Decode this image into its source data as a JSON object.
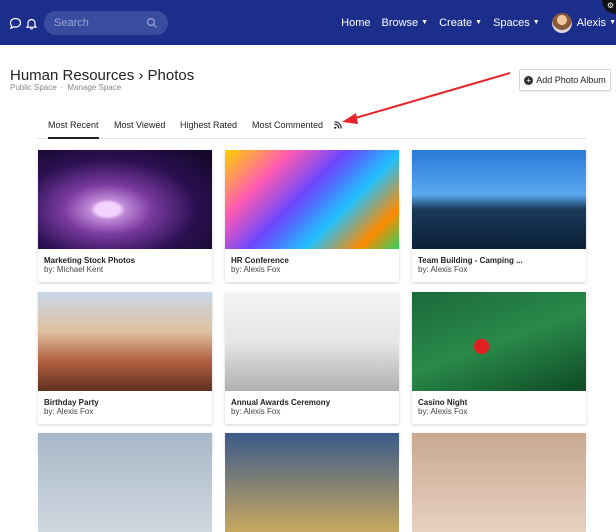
{
  "topbar": {
    "search_placeholder": "Search",
    "nav": [
      {
        "label": "Home",
        "has_caret": false
      },
      {
        "label": "Browse",
        "has_caret": true
      },
      {
        "label": "Create",
        "has_caret": true
      },
      {
        "label": "Spaces",
        "has_caret": true
      }
    ],
    "user_name": "Alexis",
    "background_color": "#1c2e8c"
  },
  "header": {
    "title": "Human Resources › Photos",
    "subtitle": [
      "Public Space",
      "Manage Space"
    ],
    "subtitle_sep": "·",
    "add_button_label": "Add Photo Album"
  },
  "tabs": [
    {
      "label": "Most Recent",
      "active": true
    },
    {
      "label": "Most Viewed",
      "active": false
    },
    {
      "label": "Highest Rated",
      "active": false
    },
    {
      "label": "Most Commented",
      "active": false
    }
  ],
  "annotation_color": "#e8232b",
  "albums": [
    {
      "name": "Marketing Stock Photos",
      "by": "by: Michael Kent"
    },
    {
      "name": "HR Conference",
      "by": "by: Alexis Fox"
    },
    {
      "name": "Team Building - Camping ...",
      "by": "by: Alexis Fox"
    },
    {
      "name": "Birthday Party",
      "by": "by: Alexis Fox"
    },
    {
      "name": "Annual Awards Ceremony",
      "by": "by: Alexis Fox"
    },
    {
      "name": "Casino Night",
      "by": "by: Alexis Fox"
    }
  ]
}
